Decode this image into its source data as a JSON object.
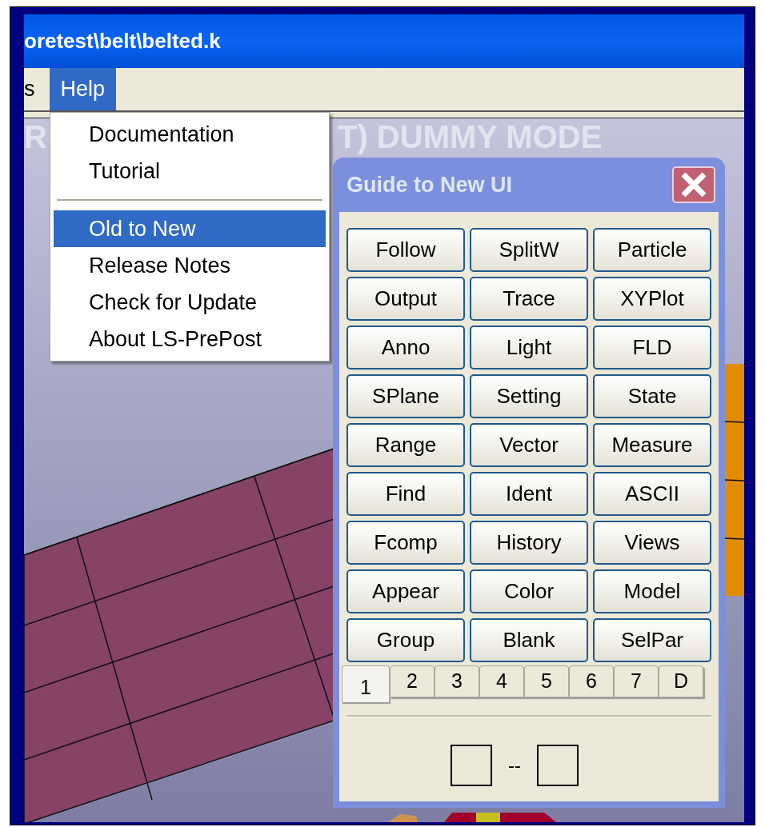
{
  "window": {
    "title": "oretest\\belt\\belted.k"
  },
  "menubar": [
    {
      "label": "s",
      "selected": false
    },
    {
      "label": "Help",
      "selected": true
    }
  ],
  "help_menu": [
    {
      "kind": "item",
      "label": "Documentation",
      "selected": false
    },
    {
      "kind": "item",
      "label": "Tutorial",
      "selected": false
    },
    {
      "kind": "separator"
    },
    {
      "kind": "item",
      "label": "Old to New",
      "selected": true
    },
    {
      "kind": "item",
      "label": "Release Notes",
      "selected": false
    },
    {
      "kind": "item",
      "label": "Check for Update",
      "selected": false
    },
    {
      "kind": "item",
      "label": "About LS-PrePost",
      "selected": false
    }
  ],
  "viewport": {
    "banner_left": "R",
    "banner_right": "T) DUMMY MODE"
  },
  "dialog": {
    "title": "Guide to New UI",
    "buttons": [
      "Follow",
      "SplitW",
      "Particle",
      "Output",
      "Trace",
      "XYPlot",
      "Anno",
      "Light",
      "FLD",
      "SPlane",
      "Setting",
      "State",
      "Range",
      "Vector",
      "Measure",
      "Find",
      "Ident",
      "ASCII",
      "Fcomp",
      "History",
      "Views",
      "Appear",
      "Color",
      "Model",
      "Group",
      "Blank",
      "SelPar"
    ],
    "tabs": [
      {
        "label": "1",
        "selected": true
      },
      {
        "label": "2",
        "selected": false
      },
      {
        "label": "3",
        "selected": false
      },
      {
        "label": "4",
        "selected": false
      },
      {
        "label": "5",
        "selected": false
      },
      {
        "label": "6",
        "selected": false
      },
      {
        "label": "7",
        "selected": false
      },
      {
        "label": "D",
        "selected": false
      }
    ],
    "range_separator": "--"
  }
}
